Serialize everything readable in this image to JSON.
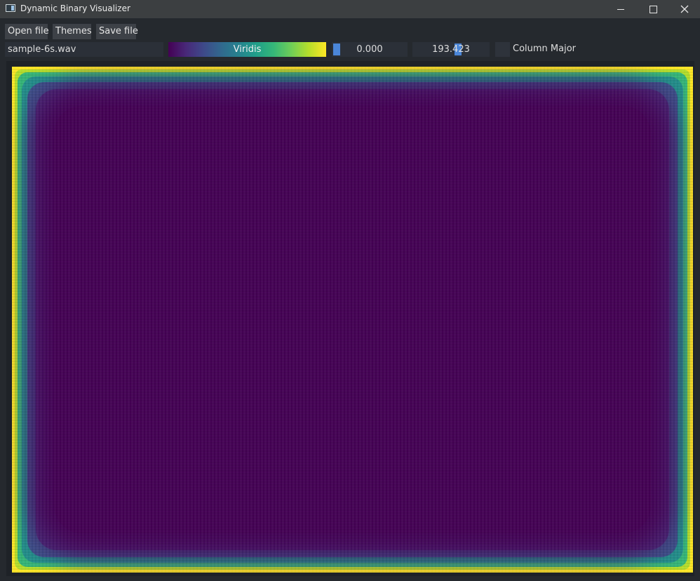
{
  "window": {
    "title": "Dynamic Binary Visualizer"
  },
  "toolbar": {
    "open_label": "Open file",
    "themes_label": "Themes",
    "save_label": "Save file"
  },
  "controls": {
    "file_name": "sample-6s.wav",
    "colormap": "Viridis",
    "min_value": "0.000",
    "max_value": "193.423",
    "column_major_label": "Column Major",
    "column_major_checked": false
  },
  "colors": {
    "accent": "#4a86d8",
    "viridis_low": "#440154",
    "viridis_high": "#fde725"
  }
}
